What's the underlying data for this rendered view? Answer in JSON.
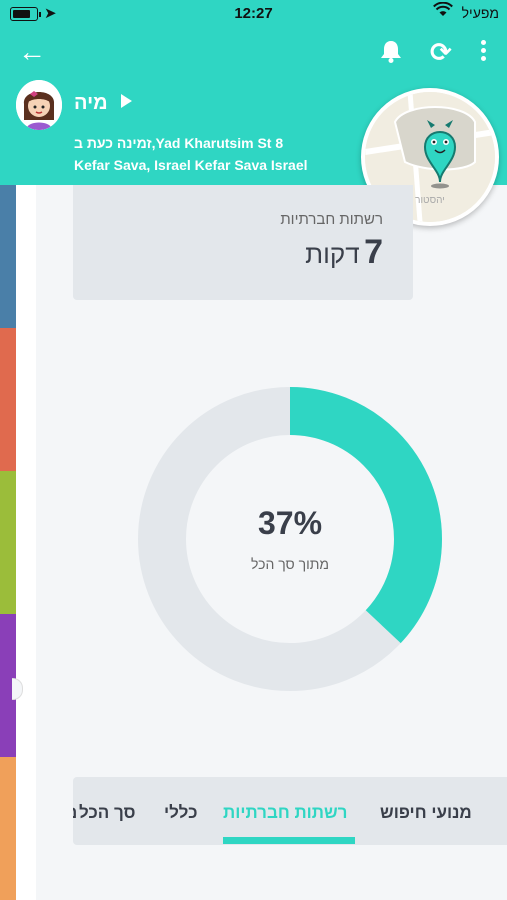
{
  "status_bar": {
    "time": "12:27",
    "carrier": "מפעיל"
  },
  "header": {
    "child_name": "מיה",
    "address_line1": "זמינה כעת ב,Yad Kharutsim St 8",
    "address_line2": "Kefar Sava, Israel Kefar Sava Israel",
    "map_caption": "יהסטור"
  },
  "usage_card": {
    "label": "רשתות חברתיות",
    "value": "7",
    "unit": "דקות"
  },
  "donut": {
    "percent_text": "37%",
    "percent_value": 37,
    "subtitle": "מתוך סך הכל"
  },
  "tabs": [
    {
      "label": "ם"
    },
    {
      "label": "מנועי חיפוש"
    },
    {
      "label": "רשתות חברתיות",
      "active": true
    },
    {
      "label": "כללי"
    },
    {
      "label": "סך הכל"
    }
  ],
  "colors": {
    "accent": "#2fd6c3",
    "donut_track": "#e3e7eb",
    "stripes": [
      "#4a7fa8",
      "#e06a4e",
      "#9bbd3a",
      "#8a3fb8",
      "#f0a05a"
    ]
  }
}
